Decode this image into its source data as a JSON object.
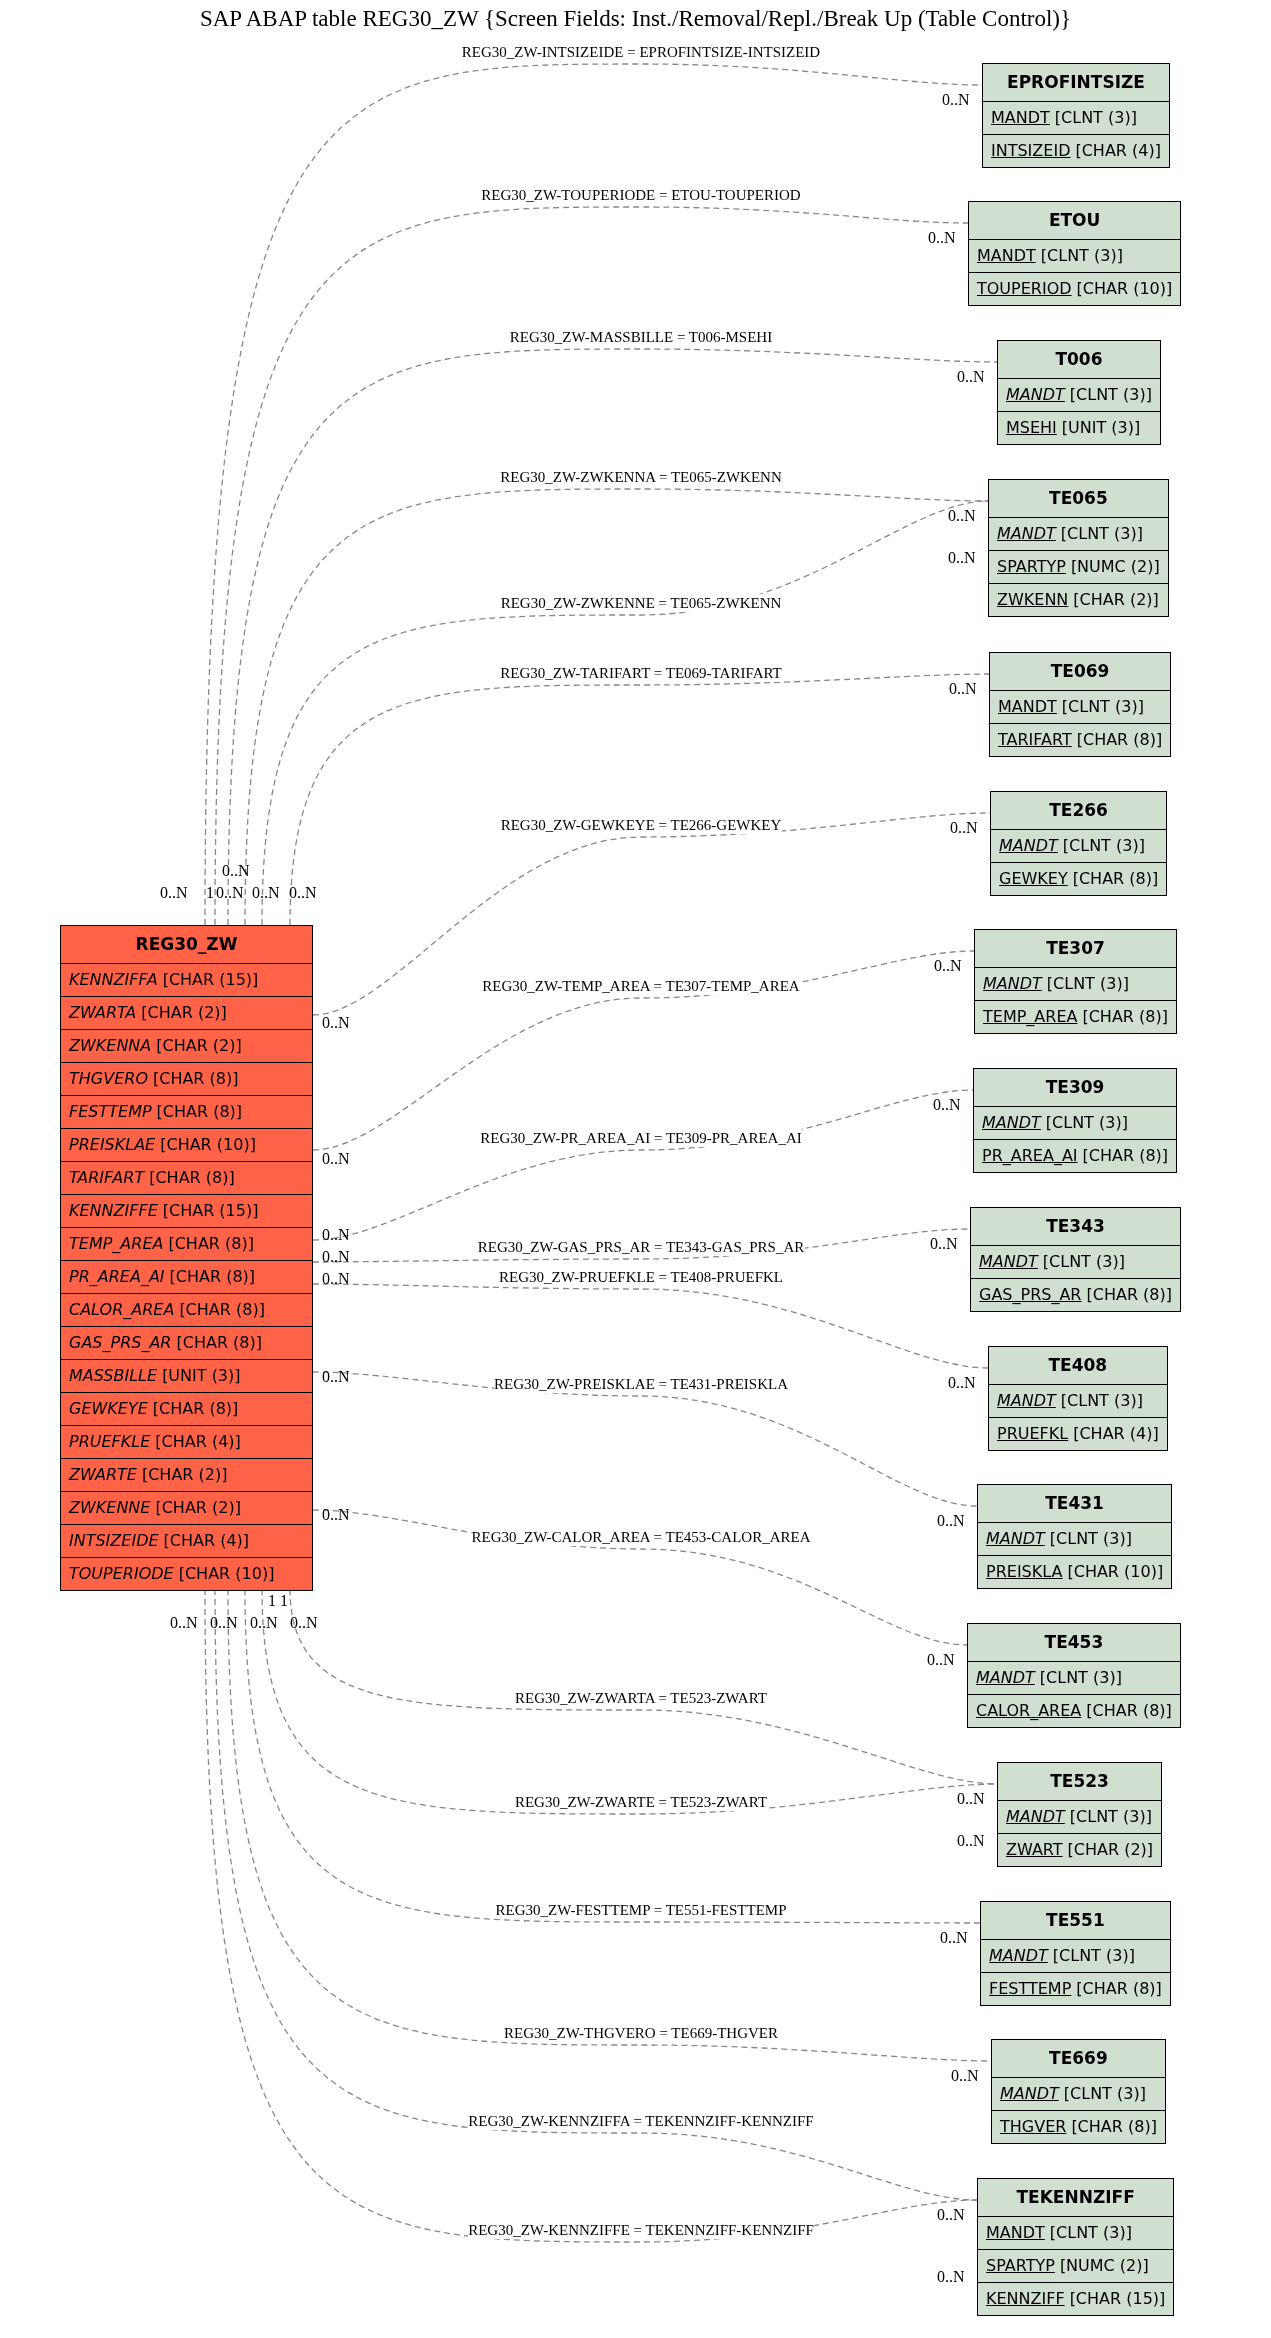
{
  "title": "SAP ABAP table REG30_ZW {Screen Fields: Inst./Removal/Repl./Break Up (Table Control)}",
  "main_table": {
    "name": "REG30_ZW",
    "fields": [
      {
        "name": "KENNZIFFA",
        "type": "[CHAR (15)]",
        "key": false,
        "italic": true
      },
      {
        "name": "ZWARTA",
        "type": "[CHAR (2)]",
        "key": false,
        "italic": true
      },
      {
        "name": "ZWKENNA",
        "type": "[CHAR (2)]",
        "key": false,
        "italic": true
      },
      {
        "name": "THGVERO",
        "type": "[CHAR (8)]",
        "key": false,
        "italic": true
      },
      {
        "name": "FESTTEMP",
        "type": "[CHAR (8)]",
        "key": false,
        "italic": true
      },
      {
        "name": "PREISKLAE",
        "type": "[CHAR (10)]",
        "key": false,
        "italic": true
      },
      {
        "name": "TARIFART",
        "type": "[CHAR (8)]",
        "key": false,
        "italic": true
      },
      {
        "name": "KENNZIFFE",
        "type": "[CHAR (15)]",
        "key": false,
        "italic": true
      },
      {
        "name": "TEMP_AREA",
        "type": "[CHAR (8)]",
        "key": false,
        "italic": true
      },
      {
        "name": "PR_AREA_AI",
        "type": "[CHAR (8)]",
        "key": false,
        "italic": true
      },
      {
        "name": "CALOR_AREA",
        "type": "[CHAR (8)]",
        "key": false,
        "italic": true
      },
      {
        "name": "GAS_PRS_AR",
        "type": "[CHAR (8)]",
        "key": false,
        "italic": true
      },
      {
        "name": "MASSBILLE",
        "type": "[UNIT (3)]",
        "key": false,
        "italic": true
      },
      {
        "name": "GEWKEYE",
        "type": "[CHAR (8)]",
        "key": false,
        "italic": true
      },
      {
        "name": "PRUEFKLE",
        "type": "[CHAR (4)]",
        "key": false,
        "italic": true
      },
      {
        "name": "ZWARTE",
        "type": "[CHAR (2)]",
        "key": false,
        "italic": true
      },
      {
        "name": "ZWKENNE",
        "type": "[CHAR (2)]",
        "key": false,
        "italic": true
      },
      {
        "name": "INTSIZEIDE",
        "type": "[CHAR (4)]",
        "key": false,
        "italic": true
      },
      {
        "name": "TOUPERIODE",
        "type": "[CHAR (10)]",
        "key": false,
        "italic": true
      }
    ]
  },
  "tables": [
    {
      "name": "EPROFINTSIZE",
      "fields": [
        {
          "name": "MANDT",
          "type": "[CLNT (3)]",
          "key": true,
          "italic": false
        },
        {
          "name": "INTSIZEID",
          "type": "[CHAR (4)]",
          "key": true,
          "italic": false
        }
      ]
    },
    {
      "name": "ETOU",
      "fields": [
        {
          "name": "MANDT",
          "type": "[CLNT (3)]",
          "key": true,
          "italic": false
        },
        {
          "name": "TOUPERIOD",
          "type": "[CHAR (10)]",
          "key": true,
          "italic": false
        }
      ]
    },
    {
      "name": "T006",
      "fields": [
        {
          "name": "MANDT",
          "type": "[CLNT (3)]",
          "key": true,
          "italic": true
        },
        {
          "name": "MSEHI",
          "type": "[UNIT (3)]",
          "key": true,
          "italic": false
        }
      ]
    },
    {
      "name": "TE065",
      "fields": [
        {
          "name": "MANDT",
          "type": "[CLNT (3)]",
          "key": true,
          "italic": true
        },
        {
          "name": "SPARTYP",
          "type": "[NUMC (2)]",
          "key": true,
          "italic": false
        },
        {
          "name": "ZWKENN",
          "type": "[CHAR (2)]",
          "key": true,
          "italic": false
        }
      ]
    },
    {
      "name": "TE069",
      "fields": [
        {
          "name": "MANDT",
          "type": "[CLNT (3)]",
          "key": true,
          "italic": false
        },
        {
          "name": "TARIFART",
          "type": "[CHAR (8)]",
          "key": true,
          "italic": false
        }
      ]
    },
    {
      "name": "TE266",
      "fields": [
        {
          "name": "MANDT",
          "type": "[CLNT (3)]",
          "key": true,
          "italic": true
        },
        {
          "name": "GEWKEY",
          "type": "[CHAR (8)]",
          "key": true,
          "italic": false
        }
      ]
    },
    {
      "name": "TE307",
      "fields": [
        {
          "name": "MANDT",
          "type": "[CLNT (3)]",
          "key": true,
          "italic": true
        },
        {
          "name": "TEMP_AREA",
          "type": "[CHAR (8)]",
          "key": true,
          "italic": false
        }
      ]
    },
    {
      "name": "TE309",
      "fields": [
        {
          "name": "MANDT",
          "type": "[CLNT (3)]",
          "key": true,
          "italic": true
        },
        {
          "name": "PR_AREA_AI",
          "type": "[CHAR (8)]",
          "key": true,
          "italic": false
        }
      ]
    },
    {
      "name": "TE343",
      "fields": [
        {
          "name": "MANDT",
          "type": "[CLNT (3)]",
          "key": true,
          "italic": true
        },
        {
          "name": "GAS_PRS_AR",
          "type": "[CHAR (8)]",
          "key": true,
          "italic": false
        }
      ]
    },
    {
      "name": "TE408",
      "fields": [
        {
          "name": "MANDT",
          "type": "[CLNT (3)]",
          "key": true,
          "italic": true
        },
        {
          "name": "PRUEFKL",
          "type": "[CHAR (4)]",
          "key": true,
          "italic": false
        }
      ]
    },
    {
      "name": "TE431",
      "fields": [
        {
          "name": "MANDT",
          "type": "[CLNT (3)]",
          "key": true,
          "italic": true
        },
        {
          "name": "PREISKLA",
          "type": "[CHAR (10)]",
          "key": true,
          "italic": false
        }
      ]
    },
    {
      "name": "TE453",
      "fields": [
        {
          "name": "MANDT",
          "type": "[CLNT (3)]",
          "key": true,
          "italic": true
        },
        {
          "name": "CALOR_AREA",
          "type": "[CHAR (8)]",
          "key": true,
          "italic": false
        }
      ]
    },
    {
      "name": "TE523",
      "fields": [
        {
          "name": "MANDT",
          "type": "[CLNT (3)]",
          "key": true,
          "italic": true
        },
        {
          "name": "ZWART",
          "type": "[CHAR (2)]",
          "key": true,
          "italic": false
        }
      ]
    },
    {
      "name": "TE551",
      "fields": [
        {
          "name": "MANDT",
          "type": "[CLNT (3)]",
          "key": true,
          "italic": true
        },
        {
          "name": "FESTTEMP",
          "type": "[CHAR (8)]",
          "key": true,
          "italic": false
        }
      ]
    },
    {
      "name": "TE669",
      "fields": [
        {
          "name": "MANDT",
          "type": "[CLNT (3)]",
          "key": true,
          "italic": true
        },
        {
          "name": "THGVER",
          "type": "[CHAR (8)]",
          "key": true,
          "italic": false
        }
      ]
    },
    {
      "name": "TEKENNZIFF",
      "fields": [
        {
          "name": "MANDT",
          "type": "[CLNT (3)]",
          "key": true,
          "italic": false
        },
        {
          "name": "SPARTYP",
          "type": "[NUMC (2)]",
          "key": true,
          "italic": false
        },
        {
          "name": "KENNZIFF",
          "type": "[CHAR (15)]",
          "key": true,
          "italic": false
        }
      ]
    }
  ],
  "relations": [
    {
      "label": "REG30_ZW-INTSIZEIDE = EPROFINTSIZE-INTSIZEID",
      "source_card": "0..N",
      "target_card": "0..N"
    },
    {
      "label": "REG30_ZW-TOUPERIODE = ETOU-TOUPERIOD",
      "source_card": "1",
      "target_card": "0..N"
    },
    {
      "label": "REG30_ZW-MASSBILLE = T006-MSEHI",
      "source_card": "0..N",
      "target_card": "0..N"
    },
    {
      "label": "REG30_ZW-ZWKENNA = TE065-ZWKENN",
      "source_card": "0..N",
      "target_card": "0..N"
    },
    {
      "label": "REG30_ZW-ZWKENNE = TE065-ZWKENN",
      "source_card": "0..N",
      "target_card": "0..N"
    },
    {
      "label": "REG30_ZW-TARIFART = TE069-TARIFART",
      "source_card": "0..N",
      "target_card": "0..N"
    },
    {
      "label": "REG30_ZW-GEWKEYE = TE266-GEWKEY",
      "source_card": "0..N",
      "target_card": "0..N"
    },
    {
      "label": "REG30_ZW-TEMP_AREA = TE307-TEMP_AREA",
      "source_card": "0..N",
      "target_card": "0..N"
    },
    {
      "label": "REG30_ZW-PR_AREA_AI = TE309-PR_AREA_AI",
      "source_card": "0..N",
      "target_card": "0..N"
    },
    {
      "label": "REG30_ZW-GAS_PRS_AR = TE343-GAS_PRS_AR",
      "source_card": "0..N",
      "target_card": "0..N"
    },
    {
      "label": "REG30_ZW-PRUEFKLE = TE408-PRUEFKL",
      "source_card": "0..N",
      "target_card": "0..N"
    },
    {
      "label": "REG30_ZW-PREISKLAE = TE431-PREISKLA",
      "source_card": "0..N",
      "target_card": "0..N"
    },
    {
      "label": "REG30_ZW-CALOR_AREA = TE453-CALOR_AREA",
      "source_card": "0..N",
      "target_card": "0..N"
    },
    {
      "label": "REG30_ZW-ZWARTA = TE523-ZWART",
      "source_card": "1",
      "target_card": "0..N"
    },
    {
      "label": "REG30_ZW-ZWARTE = TE523-ZWART",
      "source_card": "1",
      "target_card": "0..N"
    },
    {
      "label": "REG30_ZW-FESTTEMP = TE551-FESTTEMP",
      "source_card": "0..N",
      "target_card": "0..N"
    },
    {
      "label": "REG30_ZW-THGVERO = TE669-THGVER",
      "source_card": "0..N",
      "target_card": "0..N"
    },
    {
      "label": "REG30_ZW-KENNZIFFA = TEKENNZIFF-KENNZIFF",
      "source_card": "0..N",
      "target_card": "0..N"
    },
    {
      "label": "REG30_ZW-KENNZIFFE = TEKENNZIFF-KENNZIFF",
      "source_card": "0..N",
      "target_card": "0..N"
    }
  ]
}
